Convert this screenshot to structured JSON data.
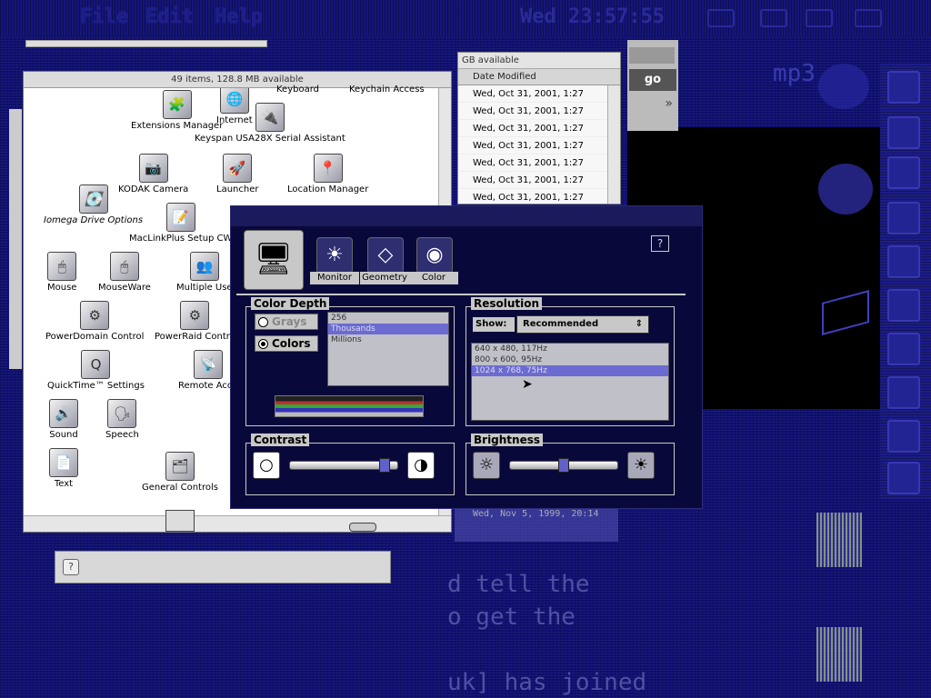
{
  "menubar": {
    "items": [
      "File",
      "Edit",
      "Help"
    ],
    "clock": "Wed 23:57:55"
  },
  "finder": {
    "status": "49 items, 128.8 MB available",
    "icons": [
      {
        "label": "Internet",
        "glyph": "🌐"
      },
      {
        "label": "Keyboard",
        "glyph": "⌨"
      },
      {
        "label": "Keychain Access",
        "glyph": "🔑"
      },
      {
        "label": "Extensions Manager",
        "glyph": "🧩"
      },
      {
        "label": "Keyspan USA28X Serial Assistant",
        "glyph": "🔌"
      },
      {
        "label": "KODAK Camera",
        "glyph": "📷"
      },
      {
        "label": "Launcher",
        "glyph": "🚀"
      },
      {
        "label": "Location Manager",
        "glyph": "📍"
      },
      {
        "label": "Iomega Drive Options",
        "glyph": "💽"
      },
      {
        "label": "MacLinkPlus Setup CW",
        "glyph": "📝"
      },
      {
        "label": "Mouse",
        "glyph": "🖱"
      },
      {
        "label": "MouseWare",
        "glyph": "🖱"
      },
      {
        "label": "Multiple Use",
        "glyph": "👥"
      },
      {
        "label": "PowerDomain Control",
        "glyph": "⚙"
      },
      {
        "label": "PowerRaid Contro",
        "glyph": "⚙"
      },
      {
        "label": "QuickTime™ Settings",
        "glyph": "Q"
      },
      {
        "label": "Remote Acce",
        "glyph": "📡"
      },
      {
        "label": "Sound",
        "glyph": "🔊"
      },
      {
        "label": "Speech",
        "glyph": "🗣"
      },
      {
        "label": "Text",
        "glyph": "📄"
      },
      {
        "label": "General Controls",
        "glyph": "🗂"
      }
    ]
  },
  "list_window": {
    "status": "GB available",
    "column": "Date Modified",
    "rows": [
      "Wed, Oct 31, 2001, 1:27",
      "Wed, Oct 31, 2001, 1:27",
      "Wed, Oct 31, 2001, 1:27",
      "Wed, Oct 31, 2001, 1:27",
      "Wed, Oct 31, 2001, 1:27",
      "Wed, Oct 31, 2001, 1:27",
      "Wed, Oct 31, 2001, 1:27"
    ]
  },
  "browser": {
    "go_label": "go",
    "ghost_text": "mp3"
  },
  "monitors": {
    "tabs": [
      "Monitor",
      "Geometry",
      "Color"
    ],
    "color_depth": {
      "title": "Color Depth",
      "modes": [
        "Grays",
        "Colors"
      ],
      "selected_mode": "Colors",
      "options": [
        "256",
        "Thousands",
        "Millions"
      ]
    },
    "resolution": {
      "title": "Resolution",
      "show_label": "Show:",
      "show_value": "Recommended",
      "options": [
        "640 x 480, 117Hz",
        "800 x 600, 95Hz",
        "1024 x 768, 75Hz"
      ],
      "selected": "1024 x 768, 75Hz"
    },
    "contrast": {
      "title": "Contrast",
      "level": 0.92
    },
    "brightness": {
      "title": "Brightness",
      "level": 0.5
    }
  },
  "ghost": {
    "lines": [
      "d tell the",
      "o get the",
      "uk] has joined"
    ],
    "date": "Wed, Nov 5, 1999, 20:14"
  }
}
